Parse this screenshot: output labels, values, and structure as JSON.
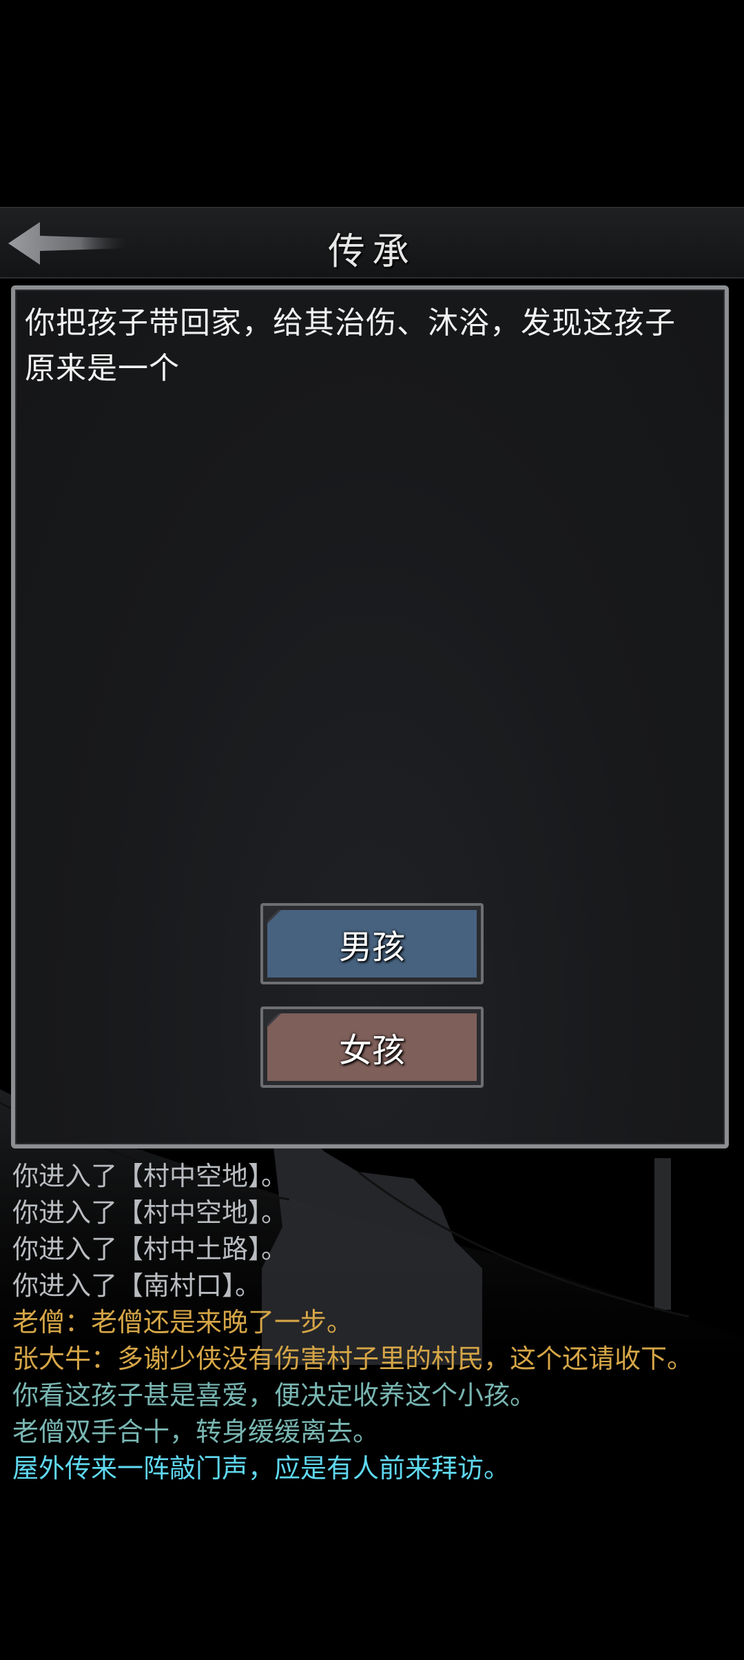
{
  "header": {
    "title": "传承"
  },
  "story": {
    "text": "你把孩子带回家，给其治伤、沐浴，发现这孩子原来是一个"
  },
  "choices": [
    {
      "label": "男孩",
      "color": "#47627f"
    },
    {
      "label": "女孩",
      "color": "#7e5f5a"
    }
  ],
  "log": [
    {
      "text": "你进入了【村中空地】。",
      "color": "#b9bcc0"
    },
    {
      "text": "你进入了【村中空地】。",
      "color": "#b9bcc0"
    },
    {
      "text": "你进入了【村中土路】。",
      "color": "#b9bcc0"
    },
    {
      "text": "你进入了【南村口】。",
      "color": "#b9bcc0"
    },
    {
      "text": "老僧：老僧还是来晚了一步。",
      "color": "#d6a647"
    },
    {
      "text": "张大牛：多谢少侠没有伤害村子里的村民，这个还请收下。",
      "color": "#d6a647"
    },
    {
      "text": "你看这孩子甚是喜爱，便决定收养这个小孩。",
      "color": "#79b6b2"
    },
    {
      "text": "老僧双手合十，转身缓缓离去。",
      "color": "#79b6b2"
    },
    {
      "text": "屋外传来一阵敲门声，应是有人前来拜访。",
      "color": "#5fd8f0"
    }
  ]
}
